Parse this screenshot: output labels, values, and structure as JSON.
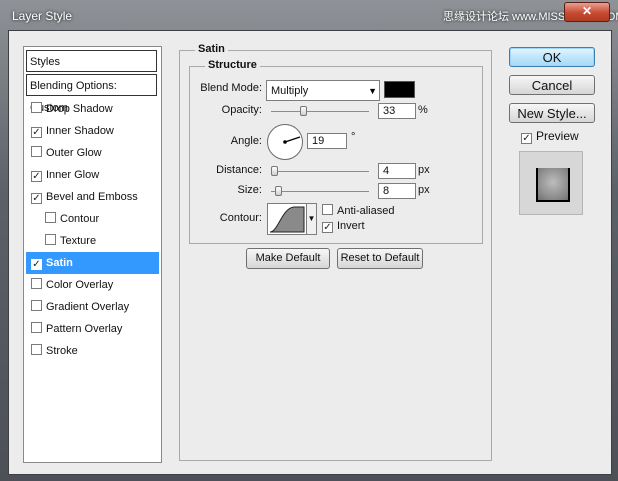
{
  "window": {
    "title": "Layer Style",
    "watermark": "思缘设计论坛 www.MISSYUAN.COM",
    "close_glyph": "✕"
  },
  "styles_panel": {
    "header": "Styles",
    "blending": "Blending Options: Custom",
    "items": [
      {
        "label": "Drop Shadow",
        "checked": false
      },
      {
        "label": "Inner Shadow",
        "checked": true
      },
      {
        "label": "Outer Glow",
        "checked": false
      },
      {
        "label": "Inner Glow",
        "checked": true
      },
      {
        "label": "Bevel and Emboss",
        "checked": true
      },
      {
        "label": "Contour",
        "checked": false
      },
      {
        "label": "Texture",
        "checked": false
      },
      {
        "label": "Satin",
        "checked": true,
        "selected": true
      },
      {
        "label": "Color Overlay",
        "checked": false
      },
      {
        "label": "Gradient Overlay",
        "checked": false
      },
      {
        "label": "Pattern Overlay",
        "checked": false
      },
      {
        "label": "Stroke",
        "checked": false
      }
    ]
  },
  "satin": {
    "title": "Satin",
    "structure_title": "Structure",
    "blend_mode_label": "Blend Mode:",
    "blend_mode_value": "Multiply",
    "blend_color": "#000000",
    "opacity_label": "Opacity:",
    "opacity_value": "33",
    "opacity_unit": "%",
    "angle_label": "Angle:",
    "angle_value": "19",
    "angle_unit": "°",
    "distance_label": "Distance:",
    "distance_value": "4",
    "distance_unit": "px",
    "size_label": "Size:",
    "size_value": "8",
    "size_unit": "px",
    "contour_label": "Contour:",
    "anti_aliased_label": "Anti-aliased",
    "anti_aliased_checked": false,
    "invert_label": "Invert",
    "invert_checked": true,
    "make_default": "Make Default",
    "reset_default": "Reset to Default"
  },
  "buttons": {
    "ok": "OK",
    "cancel": "Cancel",
    "new_style": "New Style...",
    "preview_label": "Preview",
    "preview_checked": true
  }
}
